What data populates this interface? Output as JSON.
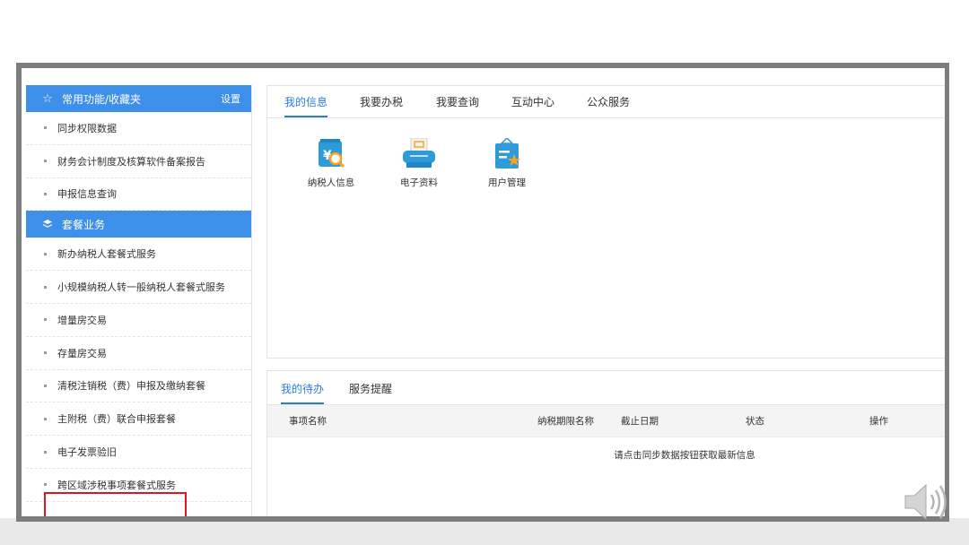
{
  "sidebar": {
    "favorites_header": {
      "title": "常用功能/收藏夹",
      "settings_label": "设置",
      "icon": "star-outline-icon"
    },
    "favorites_items": [
      "同步权限数据",
      "财务会计制度及核算软件备案报告",
      "申报信息查询"
    ],
    "package_header": {
      "title": "套餐业务",
      "icon": "layers-icon"
    },
    "package_items": [
      "新办纳税人套餐式服务",
      "小规模纳税人转一般纳税人套餐式服务",
      "增量房交易",
      "存量房交易",
      "清税注销税（费）申报及缴纳套餐",
      "主附税（费）联合申报套餐",
      "电子发票验旧",
      "跨区域涉税事项套餐式服务"
    ]
  },
  "top_panel": {
    "tabs": [
      "我的信息",
      "我要办税",
      "我要查询",
      "互动中心",
      "公众服务"
    ],
    "active_tab": 0,
    "apps": [
      {
        "label": "纳税人信息",
        "icon": "taxpayer-info-icon"
      },
      {
        "label": "电子资料",
        "icon": "electronic-documents-icon"
      },
      {
        "label": "用户管理",
        "icon": "user-management-icon"
      }
    ]
  },
  "bottom_panel": {
    "tabs": [
      "我的待办",
      "服务提醒"
    ],
    "active_tab": 0,
    "columns": [
      "事项名称",
      "纳税期限名称",
      "截止日期",
      "状态",
      "操作"
    ],
    "empty_message": "请点击同步数据按钮获取最新信息"
  },
  "colors": {
    "accent": "#3d8fea",
    "tab_active": "#2e7bd5",
    "highlight": "#e0141e"
  }
}
